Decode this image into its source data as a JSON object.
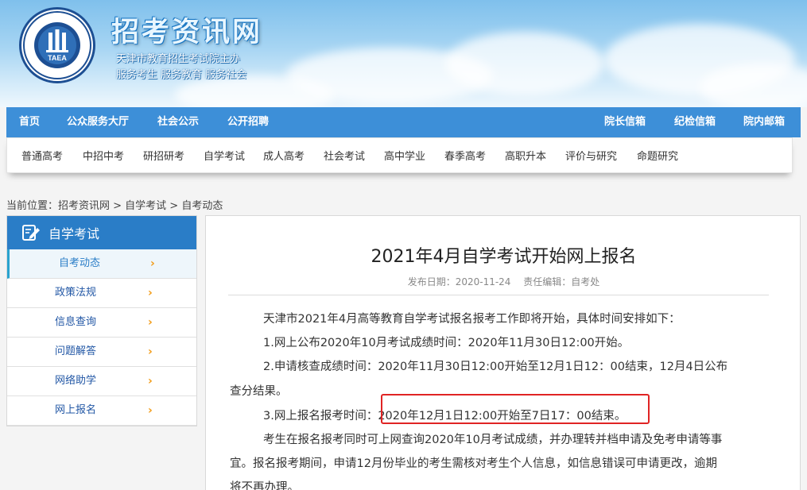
{
  "header": {
    "title": "招考资讯网",
    "subtitle1": "天津市教育招生考试院主办",
    "subtitle2": "服务考生 服务教育 服务社会",
    "logo_text": "TAEA",
    "logo_ring_text": "TIANJIN EDUCATIONAL ADMISSION & EXAMINATION AUTHORITY 天津市教育招生考试院"
  },
  "main_nav": {
    "left": [
      "首页",
      "公众服务大厅",
      "社会公示",
      "公开招聘"
    ],
    "right": [
      "院长信箱",
      "纪检信箱",
      "院内邮箱"
    ]
  },
  "sub_nav": [
    "普通高考",
    "中招中考",
    "研招研考",
    "自学考试",
    "成人高考",
    "社会考试",
    "高中学业",
    "春季高考",
    "高职升本",
    "评价与研究",
    "命题研究"
  ],
  "breadcrumb": "当前位置：招考资讯网 > 自学考试 > 自考动态",
  "sidebar": {
    "title": "自学考试",
    "items": [
      "自考动态",
      "政策法规",
      "信息查询",
      "问题解答",
      "网络助学",
      "网上报名"
    ],
    "chevron": "›"
  },
  "article": {
    "title": "2021年4月自学考试开始网上报名",
    "date": "发布日期：2020-11-24",
    "editor": "责任编辑：自考处",
    "paragraphs": [
      "天津市2021年4月高等教育自学考试报名报考工作即将开始，具体时间安排如下：",
      "1.网上公布2020年10月考试成绩时间：2020年11月30日12:00开始。",
      "2.申请核查成绩时间：2020年11月30日12:00开始至12月1日12：00结束，12月4日公布",
      "查分结果。",
      "3.网上报名报考时间：2020年12月1日12:00开始至7日17：00结束。",
      "考生在报名报考同时可上网查询2020年10月考试成绩，并办理转并档申请及免考申请等事",
      "宜。报名报考期间，申请12月份毕业的考生需核对考生个人信息，如信息错误可申请更改，逾期",
      "将不再办理。"
    ]
  },
  "colors": {
    "nav_blue": "#3d8fd8",
    "sidebar_head": "#2a7dc7",
    "highlight_red": "#e02424",
    "chevron_orange": "#f29b16"
  }
}
